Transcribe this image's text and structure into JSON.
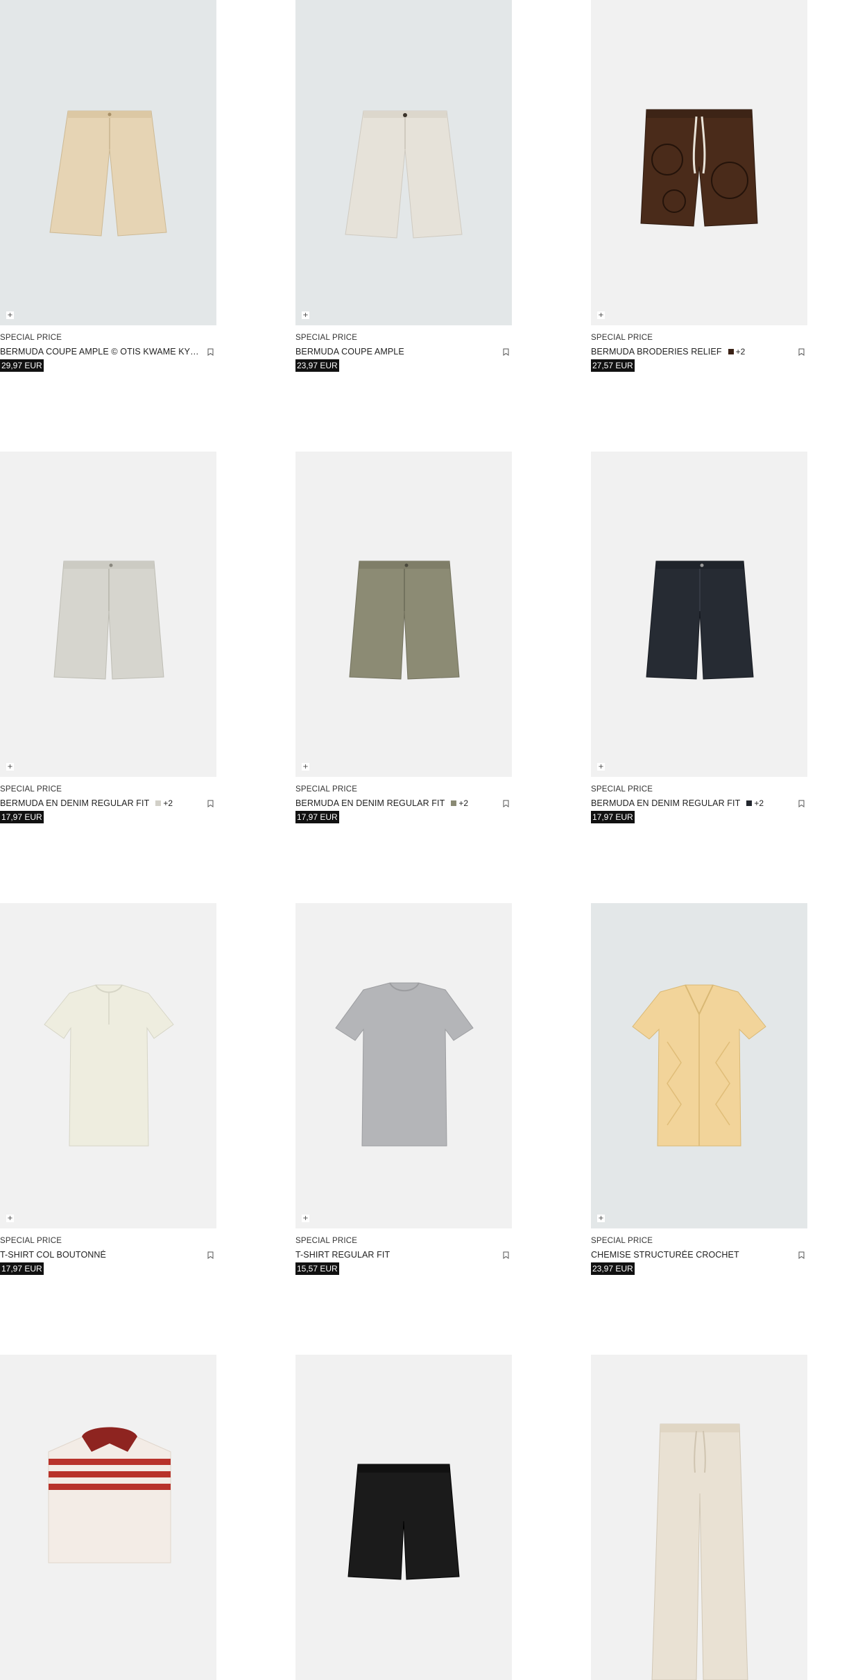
{
  "products": [
    {
      "tag": "SPECIAL PRICE",
      "name": "BERMUDA COUPE AMPLE © OTIS KWAME KYE...",
      "price": "29,97 EUR",
      "add_symbol": "+",
      "image": "beige-wide-bermuda-shorts",
      "bg": "#e3e7e8",
      "swatch": null,
      "more_colors": ""
    },
    {
      "tag": "SPECIAL PRICE",
      "name": "BERMUDA COUPE AMPLE",
      "price": "23,97 EUR",
      "add_symbol": "+",
      "image": "ecru-wide-bermuda-shorts",
      "bg": "#e3e7e8",
      "swatch": null,
      "more_colors": ""
    },
    {
      "tag": "SPECIAL PRICE",
      "name": "BERMUDA BRODERIES RELIEF",
      "price": "27,57 EUR",
      "add_symbol": "+",
      "image": "brown-embroidered-drawstring-shorts",
      "bg": "#f1f1f1",
      "swatch": "#3b2216",
      "more_colors": "+2"
    },
    {
      "tag": "SPECIAL PRICE",
      "name": "BERMUDA EN DENIM REGULAR FIT",
      "price": "17,97 EUR",
      "add_symbol": "+",
      "image": "light-grey-denim-shorts",
      "bg": "#f1f1f1",
      "swatch": "#d2d0c8",
      "more_colors": "+2"
    },
    {
      "tag": "SPECIAL PRICE",
      "name": "BERMUDA EN DENIM REGULAR FIT",
      "price": "17,97 EUR",
      "add_symbol": "+",
      "image": "khaki-denim-shorts",
      "bg": "#f1f1f1",
      "swatch": "#8a8a74",
      "more_colors": "+2"
    },
    {
      "tag": "SPECIAL PRICE",
      "name": "BERMUDA EN DENIM REGULAR FIT",
      "price": "17,97 EUR",
      "add_symbol": "+",
      "image": "navy-denim-shorts",
      "bg": "#f1f1f1",
      "swatch": "#23272e",
      "more_colors": "+2"
    },
    {
      "tag": "SPECIAL PRICE",
      "name": "T-SHIRT COL BOUTONNÉ",
      "price": "17,97 EUR",
      "add_symbol": "+",
      "image": "off-white-henley-tshirt",
      "bg": "#f1f1f1",
      "swatch": null,
      "more_colors": ""
    },
    {
      "tag": "SPECIAL PRICE",
      "name": "T-SHIRT REGULAR FIT",
      "price": "15,57 EUR",
      "add_symbol": "+",
      "image": "grey-regular-tshirt",
      "bg": "#f1f1f1",
      "swatch": null,
      "more_colors": ""
    },
    {
      "tag": "SPECIAL PRICE",
      "name": "CHEMISE STRUCTURÉE CROCHET",
      "price": "23,97 EUR",
      "add_symbol": "+",
      "image": "yellow-crochet-shirt",
      "bg": "#e3e7e8",
      "swatch": null,
      "more_colors": ""
    },
    {
      "image": "red-striped-polo-shirt",
      "bg": "#f1f1f1"
    },
    {
      "image": "black-drawstring-shorts",
      "bg": "#f1f1f1"
    },
    {
      "image": "cream-drawstring-trousers",
      "bg": "#f1f1f1"
    }
  ]
}
